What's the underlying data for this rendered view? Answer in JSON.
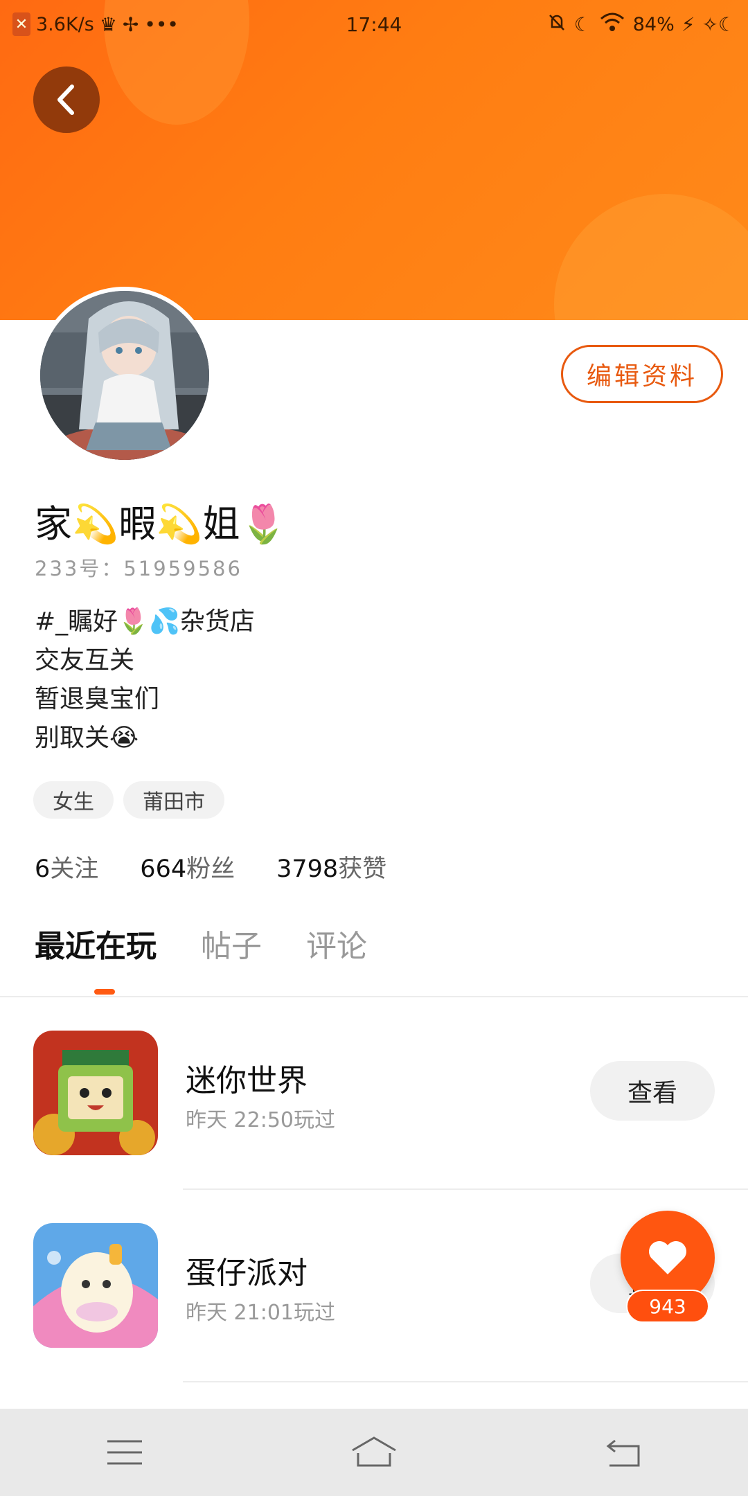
{
  "status_bar": {
    "speed": "3.6K/s",
    "time": "17:44",
    "battery": "84%",
    "icons": [
      "crown-icon",
      "fan-icon",
      "more-dots-icon",
      "bell-off-icon",
      "moon-icon",
      "wifi-icon",
      "charging-icon"
    ]
  },
  "header": {
    "back_icon": "chevron-left-icon",
    "edit_label": "编辑资料"
  },
  "profile": {
    "nickname": "家💫暇💫姐🌷",
    "uid": "233号：51959586",
    "bio": [
      "#_瞩好🌷💦杂货店",
      "交友互关",
      "暂退臭宝们",
      "别取关😭"
    ],
    "tags": [
      "女生",
      "莆田市"
    ],
    "stats": [
      {
        "num": "6",
        "label": "关注"
      },
      {
        "num": "664",
        "label": "粉丝"
      },
      {
        "num": "3798",
        "label": "获赞"
      }
    ]
  },
  "tabs": [
    "最近在玩",
    "帖子",
    "评论"
  ],
  "active_tab": 0,
  "games": [
    {
      "name": "迷你世界",
      "time": "昨天 22:50玩过",
      "button": "查看"
    },
    {
      "name": "蛋仔派对",
      "time": "昨天 21:01玩过",
      "button": "查看"
    }
  ],
  "like": {
    "icon": "heart-icon",
    "count": "943"
  },
  "navbar": {
    "icons": [
      "menu-icon",
      "home-icon",
      "back-icon"
    ]
  },
  "colors": {
    "accent": "#ff5a12",
    "banner": "#ff7a12"
  }
}
